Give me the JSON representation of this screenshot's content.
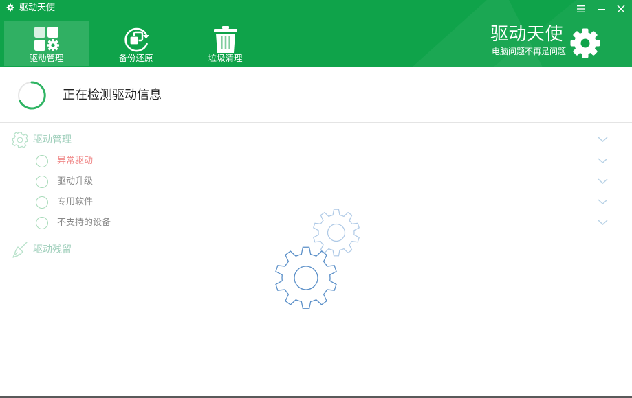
{
  "window": {
    "title": "驱动天使",
    "title_icon": "gear-icon",
    "controls": [
      "menu-icon",
      "minimize-icon",
      "close-icon"
    ]
  },
  "nav": {
    "tabs": [
      {
        "label": "驱动管理",
        "icon": "driver-management-icon",
        "active": true
      },
      {
        "label": "备份还原",
        "icon": "backup-restore-icon",
        "active": false
      },
      {
        "label": "垃圾清理",
        "icon": "trash-icon",
        "active": false
      }
    ]
  },
  "brand": {
    "title": "驱动天使",
    "slogan": "电脑问题不再是问题",
    "icon": "gear-icon"
  },
  "status": {
    "text": "正在检测驱动信息",
    "icon": "loading-spinner-icon"
  },
  "tree": {
    "management": {
      "label": "驱动管理",
      "icon": "gear-outline-icon",
      "items": [
        {
          "label": "异常驱动",
          "color": "#f08a8a"
        },
        {
          "label": "驱动升级"
        },
        {
          "label": "专用软件"
        },
        {
          "label": "不支持的设备"
        }
      ]
    },
    "residual": {
      "label": "驱动残留",
      "icon": "broom-icon"
    }
  },
  "colors": {
    "brand_green": "#0fa34a",
    "accent_light_green": "#a9dbba",
    "gear_blue": "#5a8fc8",
    "warning_red": "#f08a8a"
  }
}
